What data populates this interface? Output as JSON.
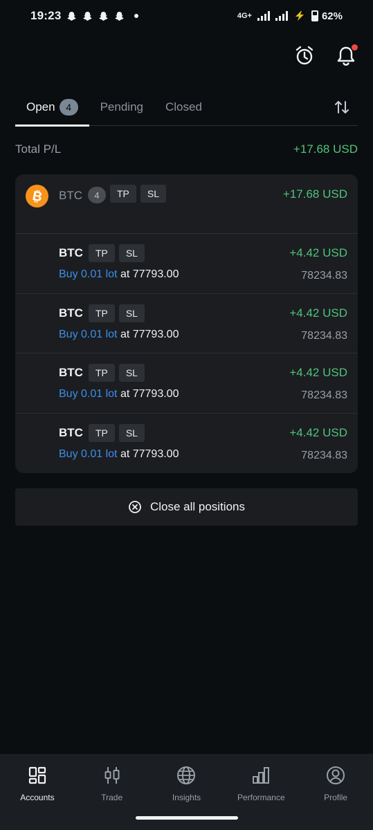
{
  "status_bar": {
    "time": "19:23",
    "network": "4G+",
    "battery": "62%"
  },
  "tabs": [
    {
      "label": "Open",
      "badge": "4"
    },
    {
      "label": "Pending"
    },
    {
      "label": "Closed"
    }
  ],
  "summary": {
    "label": "Total P/L",
    "value": "+17.68 USD"
  },
  "group": {
    "symbol": "BTC",
    "count": "4",
    "tp_label": "TP",
    "sl_label": "SL",
    "pnl": "+17.68 USD"
  },
  "positions": [
    {
      "symbol": "BTC",
      "tp": "TP",
      "sl": "SL",
      "side": "Buy 0.01 lot",
      "at": " at ",
      "open_price": "77793.00",
      "pnl": "+4.42 USD",
      "current_price": "78234.83"
    },
    {
      "symbol": "BTC",
      "tp": "TP",
      "sl": "SL",
      "side": "Buy 0.01 lot",
      "at": " at ",
      "open_price": "77793.00",
      "pnl": "+4.42 USD",
      "current_price": "78234.83"
    },
    {
      "symbol": "BTC",
      "tp": "TP",
      "sl": "SL",
      "side": "Buy 0.01 lot",
      "at": " at ",
      "open_price": "77793.00",
      "pnl": "+4.42 USD",
      "current_price": "78234.83"
    },
    {
      "symbol": "BTC",
      "tp": "TP",
      "sl": "SL",
      "side": "Buy 0.01 lot",
      "at": " at ",
      "open_price": "77793.00",
      "pnl": "+4.42 USD",
      "current_price": "78234.83"
    }
  ],
  "actions": {
    "close_all": "Close all positions"
  },
  "nav": [
    {
      "label": "Accounts",
      "icon": "accounts-icon"
    },
    {
      "label": "Trade",
      "icon": "trade-icon"
    },
    {
      "label": "Insights",
      "icon": "globe-icon"
    },
    {
      "label": "Performance",
      "icon": "performance-icon"
    },
    {
      "label": "Profile",
      "icon": "profile-icon"
    }
  ],
  "colors": {
    "profit": "#4fc47b",
    "buy": "#3d8ee8",
    "btc": "#f7931a",
    "alert": "#f04646"
  }
}
